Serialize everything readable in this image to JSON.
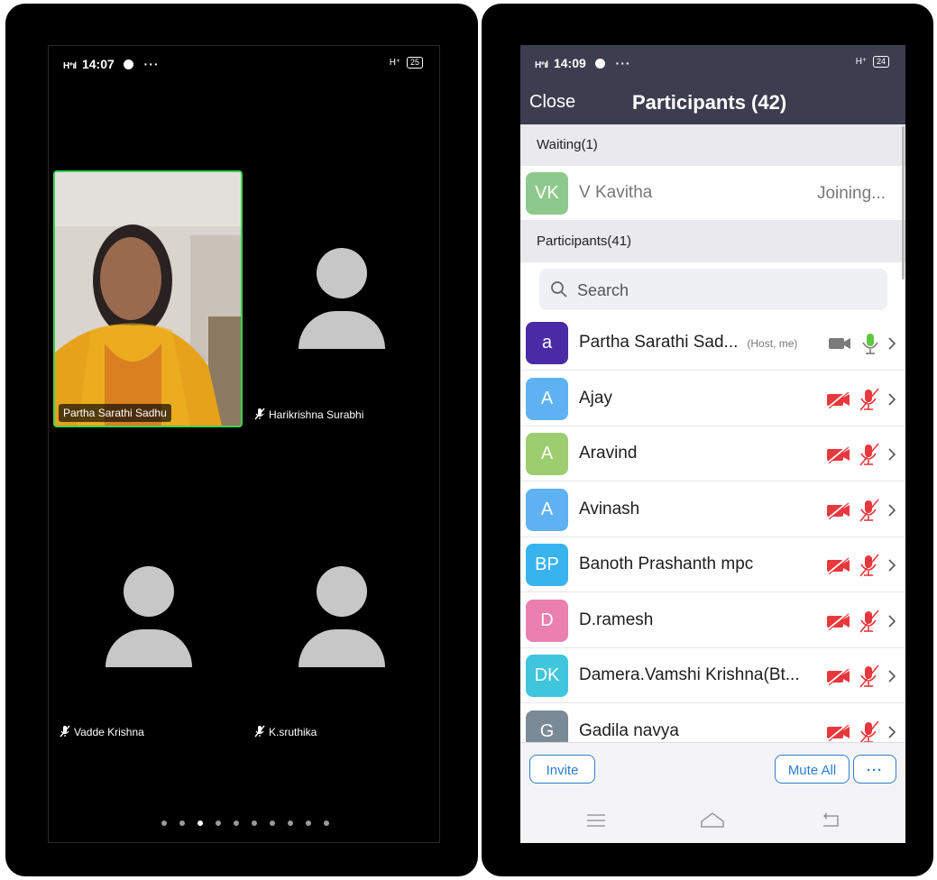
{
  "left_screen": {
    "status": {
      "time": "14:07",
      "network": "H⁺ıl",
      "more": "···",
      "right_network": "H⁺",
      "battery": "25"
    },
    "tiles": [
      {
        "name": "Partha Sarathi Sadhu",
        "video_on": true,
        "muted": false
      },
      {
        "name": "Harikrishna Surabhi",
        "video_on": false,
        "muted": true
      },
      {
        "name": "Vadde  Krishna",
        "video_on": false,
        "muted": true
      },
      {
        "name": "K.sruthika",
        "video_on": false,
        "muted": true
      }
    ],
    "page_dots": {
      "count": 10,
      "active_index": 2
    }
  },
  "right_screen": {
    "status": {
      "time": "14:09",
      "network": "H⁺ıl",
      "more": "···",
      "right_network": "H⁺",
      "battery": "24"
    },
    "header": {
      "close_label": "Close",
      "title": "Participants (42)"
    },
    "waiting": {
      "label": "Waiting(1)",
      "items": [
        {
          "initials": "VK",
          "name": "V Kavitha",
          "status": "Joining...",
          "color": "#8dc98c"
        }
      ]
    },
    "participants": {
      "label": "Participants(41)",
      "search_placeholder": "Search",
      "items": [
        {
          "initials": "a",
          "name": "Partha Sarathi Sad...",
          "tag": "(Host, me)",
          "color": "#4b2aa6",
          "video": "on",
          "audio": "on"
        },
        {
          "initials": "A",
          "name": "Ajay",
          "tag": "",
          "color": "#5fb2f2",
          "video": "off",
          "audio": "off"
        },
        {
          "initials": "A",
          "name": "Aravind",
          "tag": "",
          "color": "#9ccd6f",
          "video": "off",
          "audio": "off"
        },
        {
          "initials": "A",
          "name": "Avinash",
          "tag": "",
          "color": "#5fb2f2",
          "video": "off",
          "audio": "off"
        },
        {
          "initials": "BP",
          "name": "Banoth Prashanth mpc",
          "tag": "",
          "color": "#38b3ee",
          "video": "off",
          "audio": "off"
        },
        {
          "initials": "D",
          "name": "D.ramesh",
          "tag": "",
          "color": "#ea7fb0",
          "video": "off",
          "audio": "off"
        },
        {
          "initials": "DK",
          "name": "Damera.Vamshi Krishna(Bt...",
          "tag": "",
          "color": "#3fc6dc",
          "video": "off",
          "audio": "off"
        },
        {
          "initials": "G",
          "name": "Gadila navya",
          "tag": "",
          "color": "#7a8a96",
          "video": "off",
          "audio": "off"
        }
      ]
    },
    "toolbar": {
      "invite_label": "Invite",
      "mute_all_label": "Mute All",
      "more_label": "···"
    },
    "colors": {
      "header_bg": "#3d3d50",
      "accent": "#2d7dd2",
      "mic_on": "#5fc63f",
      "muted_red": "#e8383d"
    }
  }
}
